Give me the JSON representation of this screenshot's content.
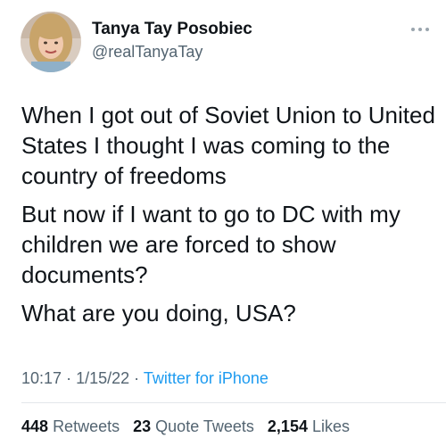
{
  "author": {
    "display_name": "Tanya Tay Posobiec",
    "handle": "@realTanyaTay",
    "avatar_icon": "profile-photo"
  },
  "more_icon": "ellipsis-icon",
  "tweet": {
    "paragraphs": [
      "When I got out of Soviet Union to United States I thought I was coming to the country of freedoms",
      "But now if I want to go to DC with my children we are forced to show documents?",
      "What are you doing, USA?"
    ],
    "time": "10:17",
    "date": "1/15/22",
    "separator": "·",
    "source": "Twitter for iPhone"
  },
  "stats": {
    "retweets_count": "448",
    "retweets_label": "Retweets",
    "quote_tweets_count": "23",
    "quote_tweets_label": "Quote Tweets",
    "likes_count": "2,154",
    "likes_label": "Likes"
  },
  "colors": {
    "text": "#0f1419",
    "secondary": "#536471",
    "link": "#1d9bf0"
  }
}
